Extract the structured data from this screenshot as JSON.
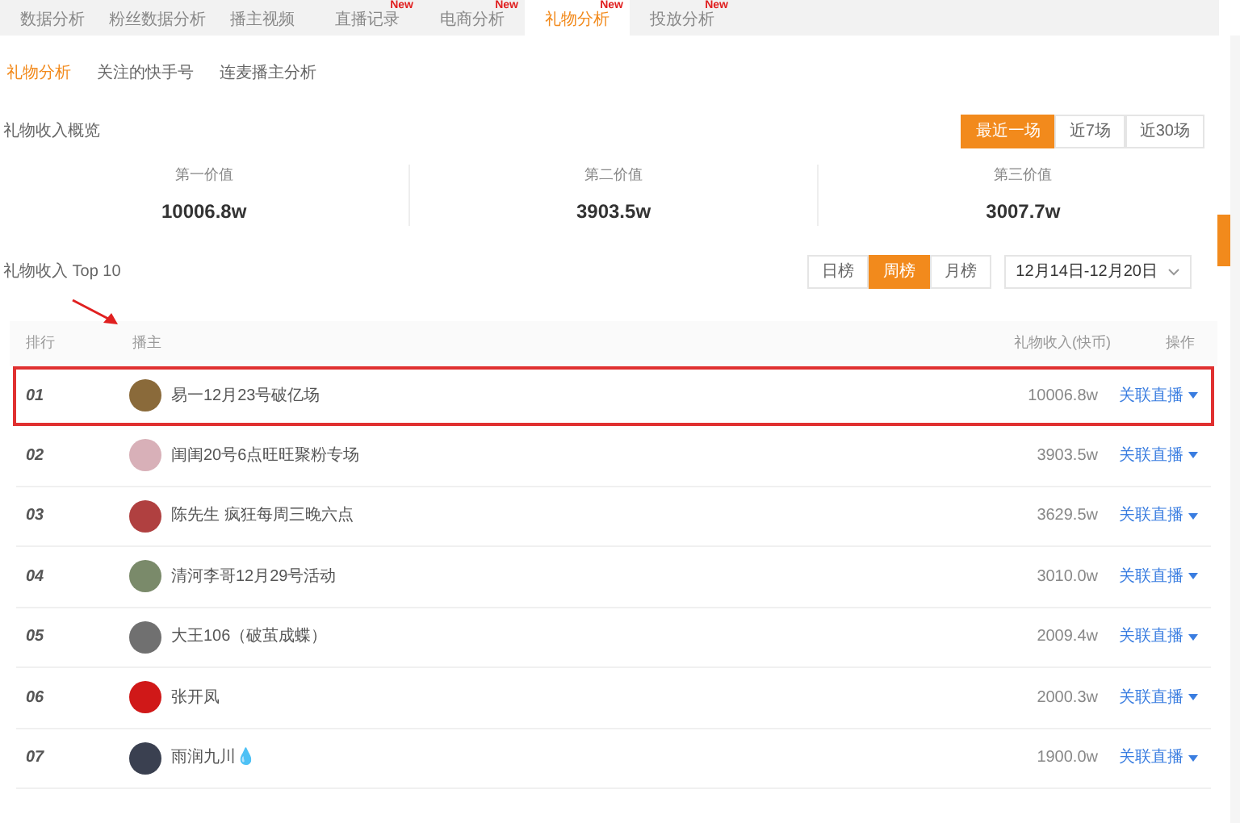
{
  "tabs": [
    {
      "label": "数据分析",
      "selected": false
    },
    {
      "label": "粉丝数据分析",
      "selected": false
    },
    {
      "label": "播主视频",
      "selected": false
    },
    {
      "label": "直播记录",
      "selected": false,
      "badge": "New"
    },
    {
      "label": "电商分析",
      "selected": false,
      "badge": "New"
    },
    {
      "label": "礼物分析",
      "selected": true,
      "badge": "New"
    },
    {
      "label": "投放分析",
      "selected": false,
      "badge": "New"
    }
  ],
  "sub_tabs": [
    {
      "label": "礼物分析",
      "selected": true
    },
    {
      "label": "关注的快手号",
      "selected": false
    },
    {
      "label": "连麦播主分析",
      "selected": false
    }
  ],
  "overview": {
    "title": "礼物收入概览",
    "ranges": [
      {
        "label": "最近一场",
        "selected": true
      },
      {
        "label": "近7场",
        "selected": false
      },
      {
        "label": "近30场",
        "selected": false
      }
    ],
    "stats": [
      {
        "label": "第一价值",
        "value": "10006.8w"
      },
      {
        "label": "第二价值",
        "value": "3903.5w"
      },
      {
        "label": "第三价值",
        "value": "3007.7w"
      }
    ]
  },
  "top10": {
    "title": "礼物收入 Top 10",
    "periods": [
      {
        "label": "日榜",
        "selected": false
      },
      {
        "label": "周榜",
        "selected": true
      },
      {
        "label": "月榜",
        "selected": false
      }
    ],
    "date_range": "12月14日-12月20日"
  },
  "table": {
    "columns": [
      "排行",
      "播主",
      "礼物收入(快币)",
      "操作"
    ],
    "rows": [
      {
        "rank": "01",
        "name": "易一12月23号破亿场",
        "income": "10006.8w",
        "action": "关联直播",
        "highlighted": true
      },
      {
        "rank": "02",
        "name": "闺闺20号6点旺旺聚粉专场",
        "income": "3903.5w",
        "action": "关联直播",
        "highlighted": false
      },
      {
        "rank": "03",
        "name": "陈先生 疯狂每周三晚六点",
        "income": "3629.5w",
        "action": "关联直播",
        "highlighted": false
      },
      {
        "rank": "04",
        "name": "清河李哥12月29号活动",
        "income": "3010.0w",
        "action": "关联直播",
        "highlighted": false
      },
      {
        "rank": "05",
        "name": "大王106（破茧成蝶）",
        "income": "2009.4w",
        "action": "关联直播",
        "highlighted": false
      },
      {
        "rank": "06",
        "name": "张开凤",
        "income": "2000.3w",
        "action": "关联直播",
        "highlighted": false
      },
      {
        "rank": "07",
        "name": "雨润九川💧",
        "income": "1900.0w",
        "action": "关联直播",
        "highlighted": false
      }
    ]
  }
}
